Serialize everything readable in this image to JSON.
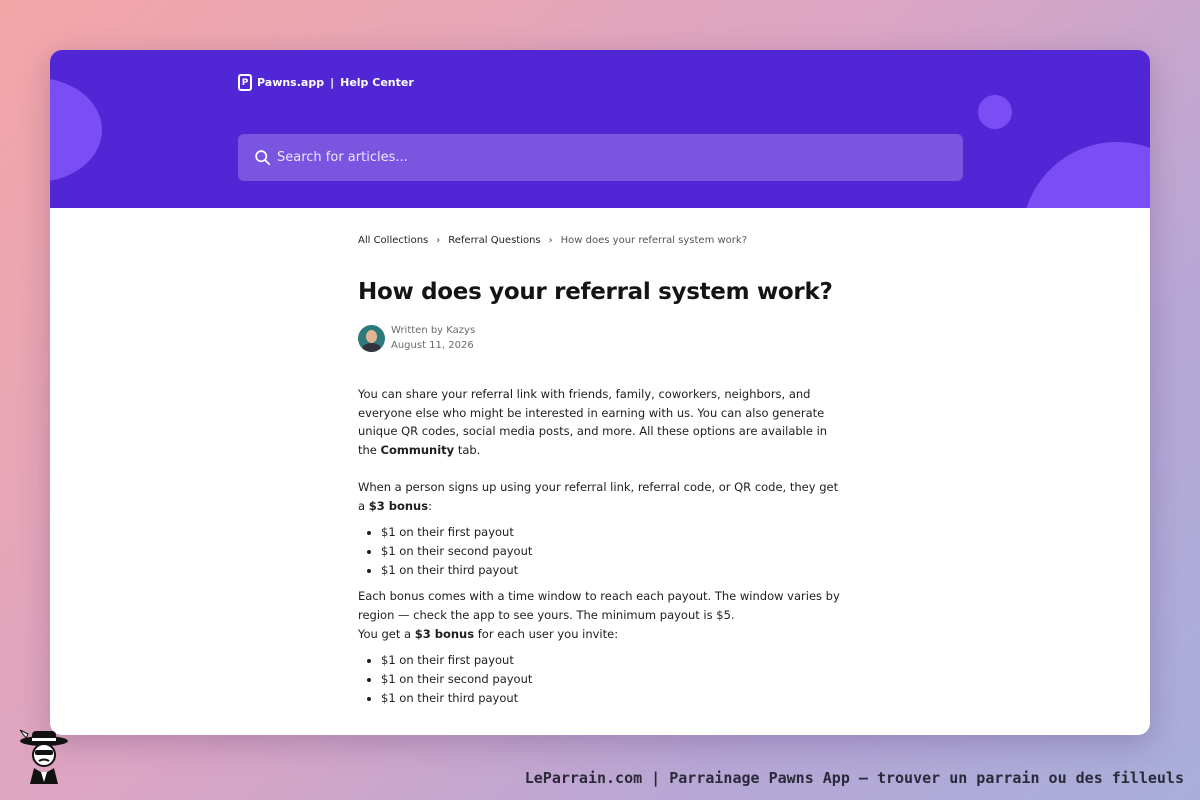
{
  "header": {
    "brand_logo": "P",
    "brand_name": "Pawns.app",
    "separator": "|",
    "section": "Help Center",
    "accent": "#5126d4",
    "blob_color": "#7a4df5"
  },
  "search": {
    "placeholder": "Search for articles...",
    "icon": "search-icon"
  },
  "breadcrumb": {
    "items": [
      "All Collections",
      "Referral Questions",
      "How does your referral system work?"
    ],
    "separator": "›"
  },
  "article": {
    "title": "How does your referral system work?",
    "author_line": "Written by Kazys",
    "date": "August 11, 2026",
    "para1": "You can share your referral link with friends, family, coworkers, neighbors, and everyone else who might be interested in earning with us. You can also generate unique QR codes, social media posts, and more. All these options are available in the",
    "para1_bold": "Community",
    "para1_end": "tab.",
    "para2": "When a person signs up using your referral link, referral code, or QR code, they get a",
    "para2_bold": "$3 bonus",
    "para2_end": ":",
    "list1": [
      "$1 on their first payout",
      "$1 on their second payout",
      "$1 on their third payout"
    ],
    "para3": "Each bonus comes with a time window to reach each payout. The window varies by region — check the app to see yours. The minimum payout is $5.",
    "para4_start": "You get a",
    "para4_bold": "$3 bonus",
    "para4_end": "for each user you invite:",
    "list2": [
      "$1 on their first payout",
      "$1 on their second payout",
      "$1 on their third payout"
    ]
  },
  "footer": {
    "text": "LeParrain.com | Parrainage Pawns App — trouver un parrain ou des filleuls"
  }
}
